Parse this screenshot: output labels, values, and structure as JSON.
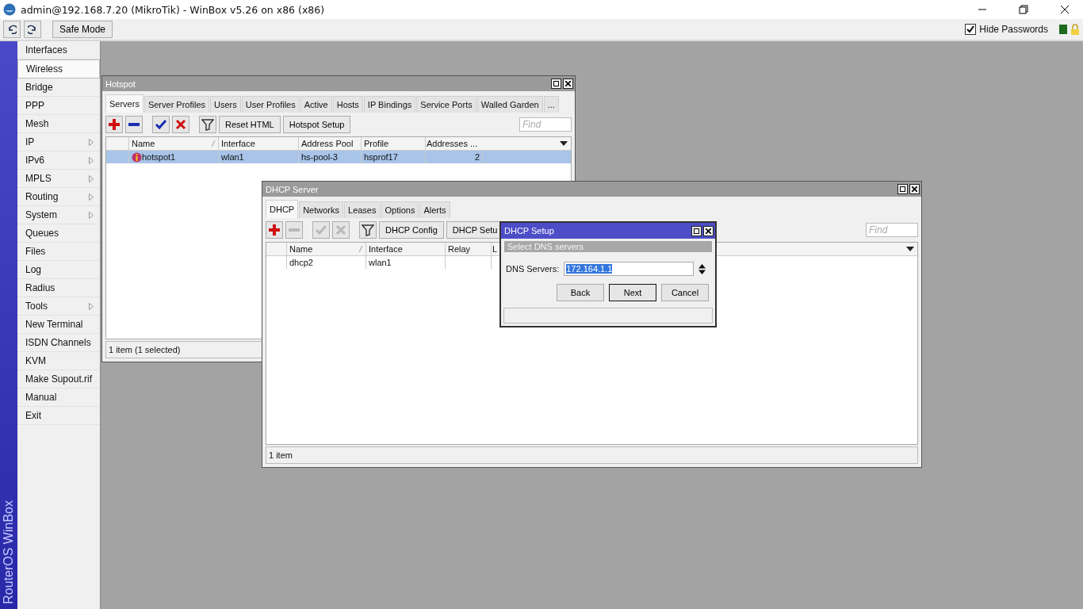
{
  "window": {
    "title": "admin@192.168.7.20 (MikroTik) - WinBox v5.26 on x86 (x86)"
  },
  "toolbar": {
    "safe_mode": "Safe Mode",
    "hide_passwords": {
      "label": "Hide Passwords",
      "checked": true
    }
  },
  "sidebar": {
    "brand": "RouterOS WinBox",
    "items": [
      {
        "label": "Interfaces",
        "submenu": false,
        "selected": false
      },
      {
        "label": "Wireless",
        "submenu": false,
        "selected": true
      },
      {
        "label": "Bridge",
        "submenu": false,
        "selected": false
      },
      {
        "label": "PPP",
        "submenu": false,
        "selected": false
      },
      {
        "label": "Mesh",
        "submenu": false,
        "selected": false
      },
      {
        "label": "IP",
        "submenu": true,
        "selected": false
      },
      {
        "label": "IPv6",
        "submenu": true,
        "selected": false
      },
      {
        "label": "MPLS",
        "submenu": true,
        "selected": false
      },
      {
        "label": "Routing",
        "submenu": true,
        "selected": false
      },
      {
        "label": "System",
        "submenu": true,
        "selected": false
      },
      {
        "label": "Queues",
        "submenu": false,
        "selected": false
      },
      {
        "label": "Files",
        "submenu": false,
        "selected": false
      },
      {
        "label": "Log",
        "submenu": false,
        "selected": false
      },
      {
        "label": "Radius",
        "submenu": false,
        "selected": false
      },
      {
        "label": "Tools",
        "submenu": true,
        "selected": false
      },
      {
        "label": "New Terminal",
        "submenu": false,
        "selected": false
      },
      {
        "label": "ISDN Channels",
        "submenu": false,
        "selected": false
      },
      {
        "label": "KVM",
        "submenu": false,
        "selected": false
      },
      {
        "label": "Make Supout.rif",
        "submenu": false,
        "selected": false
      },
      {
        "label": "Manual",
        "submenu": false,
        "selected": false
      },
      {
        "label": "Exit",
        "submenu": false,
        "selected": false
      }
    ]
  },
  "windows": [
    {
      "title": "Hotspot",
      "tabs": [
        {
          "label": "Servers",
          "selected": true
        },
        {
          "label": "Server Profiles",
          "selected": false
        },
        {
          "label": "Users",
          "selected": false
        },
        {
          "label": "User Profiles",
          "selected": false
        },
        {
          "label": "Active",
          "selected": false
        },
        {
          "label": "Hosts",
          "selected": false
        },
        {
          "label": "IP Bindings",
          "selected": false
        },
        {
          "label": "Service Ports",
          "selected": false
        },
        {
          "label": "Walled Garden",
          "selected": false
        },
        {
          "label": "...",
          "selected": false
        }
      ],
      "tools": [
        {
          "kind": "add",
          "disabled": false
        },
        {
          "kind": "remove",
          "disabled": false
        },
        {
          "kind": "enable",
          "disabled": false
        },
        {
          "kind": "disable",
          "disabled": false
        },
        {
          "kind": "filter",
          "disabled": false
        }
      ],
      "buttons": [
        "Reset HTML",
        "Hotspot Setup"
      ],
      "find": {
        "placeholder": "Find"
      },
      "columns": [
        {
          "label": "Name",
          "sorted": true
        },
        {
          "label": "Interface",
          "sorted": false
        },
        {
          "label": "Address Pool",
          "sorted": false
        },
        {
          "label": "Profile",
          "sorted": false
        },
        {
          "label": "Addresses ...",
          "sorted": false
        }
      ],
      "rows": [
        {
          "cells": [
            "hotspot1",
            "wlan1",
            "hs-pool-3",
            "hsprof17",
            "2"
          ],
          "selected": true,
          "flagged": true
        }
      ],
      "status": "1 item (1 selected)"
    },
    {
      "title": "DHCP Server",
      "tabs": [
        {
          "label": "DHCP",
          "selected": true
        },
        {
          "label": "Networks",
          "selected": false
        },
        {
          "label": "Leases",
          "selected": false
        },
        {
          "label": "Options",
          "selected": false
        },
        {
          "label": "Alerts",
          "selected": false
        }
      ],
      "tools": [
        {
          "kind": "add",
          "disabled": false
        },
        {
          "kind": "remove",
          "disabled": true
        },
        {
          "kind": "enable",
          "disabled": true
        },
        {
          "kind": "disable",
          "disabled": true
        },
        {
          "kind": "filter",
          "disabled": false
        }
      ],
      "buttons": [
        "DHCP Config",
        "DHCP Setu"
      ],
      "find": {
        "placeholder": "Find"
      },
      "columns": [
        {
          "label": "Name",
          "sorted": true
        },
        {
          "label": "Interface",
          "sorted": false
        },
        {
          "label": "Relay",
          "sorted": false
        },
        {
          "label": "L"
        }
      ],
      "rows": [
        {
          "cells": [
            "dhcp2",
            "wlan1",
            "",
            ""
          ],
          "selected": false,
          "flagged": false
        }
      ],
      "status": "1 item"
    }
  ],
  "dialog": {
    "title": "DHCP Setup",
    "step": "Select DNS servers",
    "field": {
      "label": "DNS Servers:",
      "value": "172.164.1.1"
    },
    "buttons": [
      {
        "label": "Back",
        "default": false
      },
      {
        "label": "Next",
        "default": true
      },
      {
        "label": "Cancel",
        "default": false
      }
    ]
  }
}
